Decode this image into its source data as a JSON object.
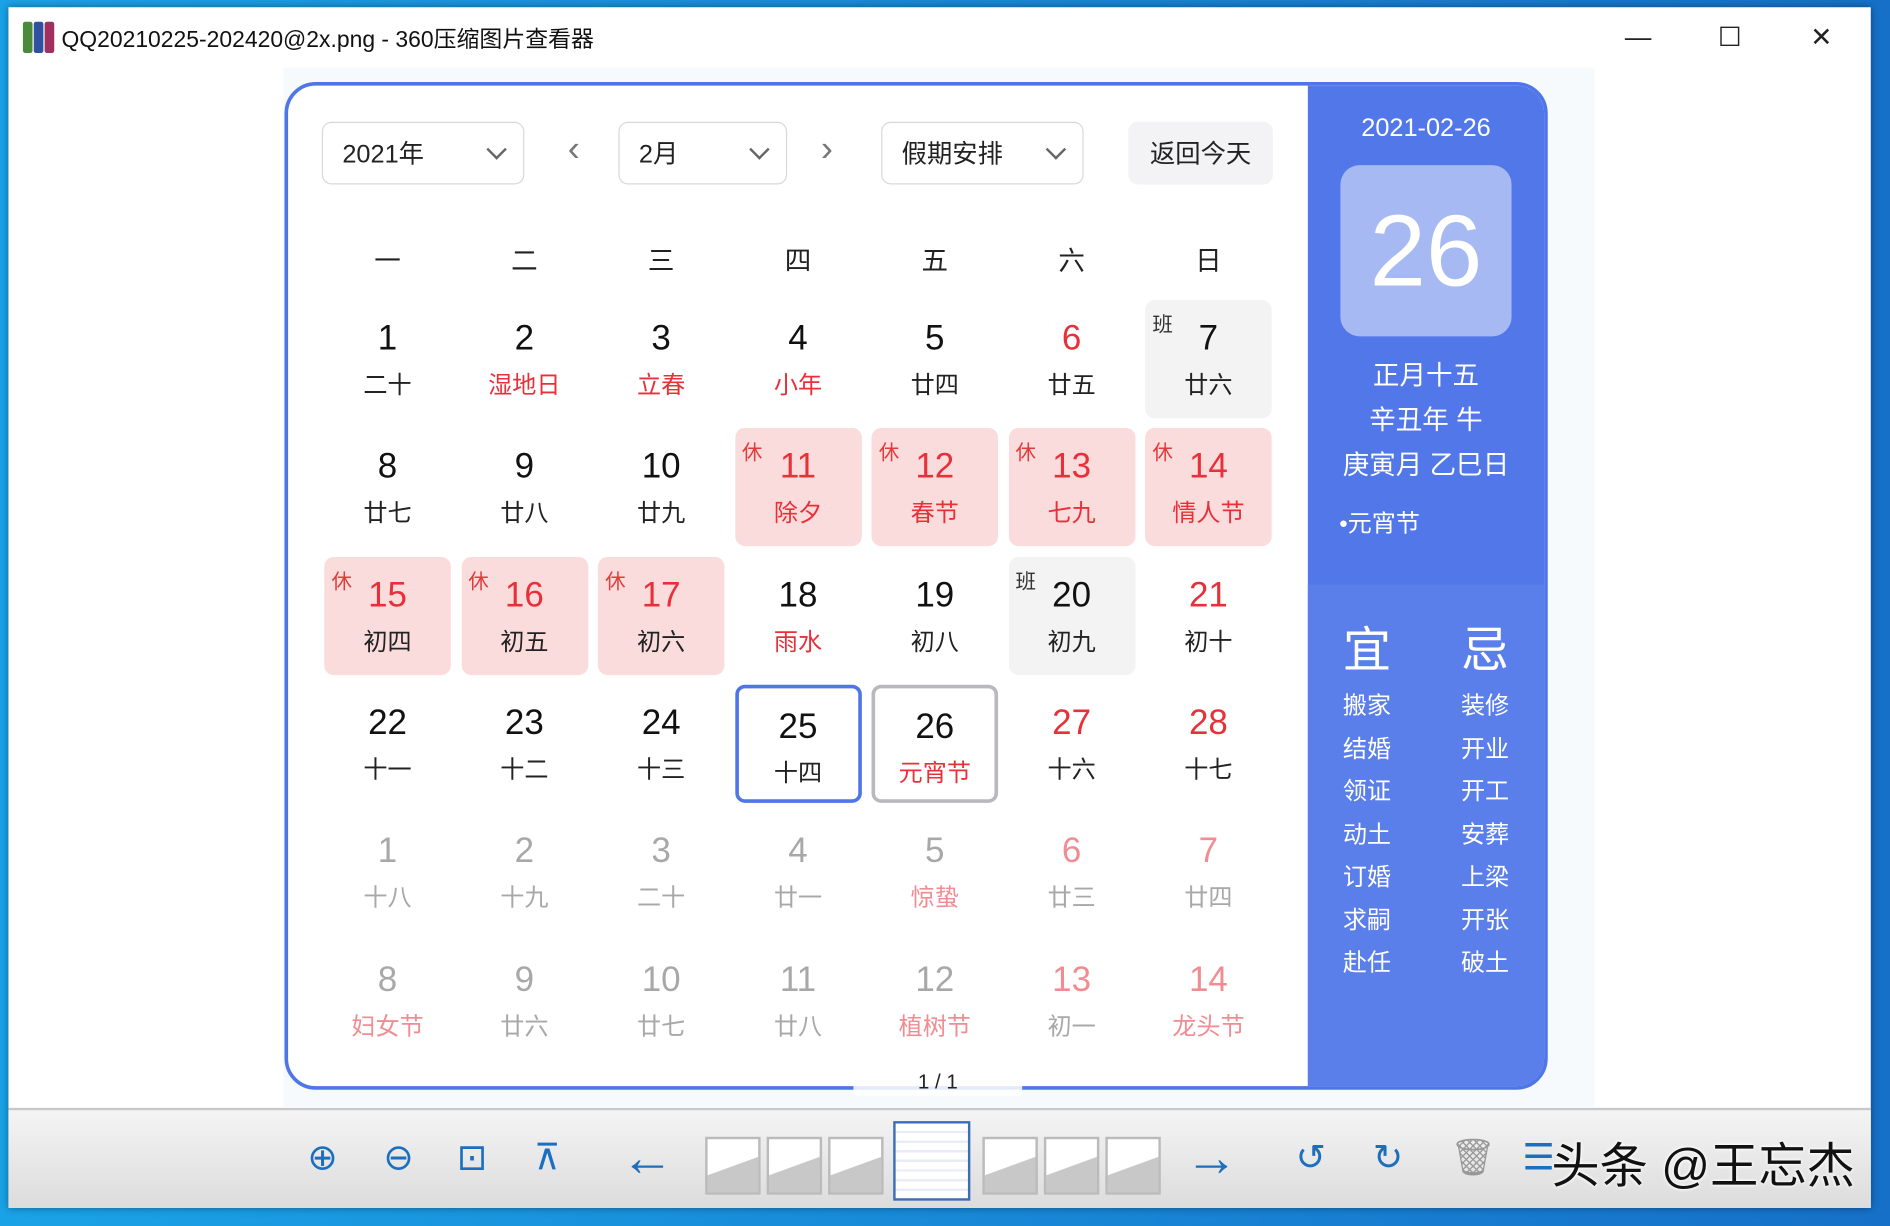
{
  "window": {
    "title": "QQ20210225-202420@2x.png - 360压缩图片查看器",
    "minimize": "—",
    "maximize": "☐",
    "close": "✕"
  },
  "calendar": {
    "year_select": "2021年",
    "month_select": "2月",
    "holiday_select": "假期安排",
    "prev": "‹",
    "next": "›",
    "today_button": "返回今天",
    "weekdays": [
      "一",
      "二",
      "三",
      "四",
      "五",
      "六",
      "日"
    ],
    "rows": [
      [
        {
          "d": "1",
          "l": "二十"
        },
        {
          "d": "2",
          "l": "湿地日",
          "lred": true
        },
        {
          "d": "3",
          "l": "立春",
          "lred": true
        },
        {
          "d": "4",
          "l": "小年",
          "lred": true
        },
        {
          "d": "5",
          "l": "廿四"
        },
        {
          "d": "6",
          "l": "廿五",
          "red": true
        },
        {
          "d": "7",
          "l": "廿六",
          "tag": "班",
          "bg": "work"
        }
      ],
      [
        {
          "d": "8",
          "l": "廿七"
        },
        {
          "d": "9",
          "l": "廿八"
        },
        {
          "d": "10",
          "l": "廿九"
        },
        {
          "d": "11",
          "l": "除夕",
          "tag": "休",
          "bg": "rest",
          "red": true,
          "lred": true
        },
        {
          "d": "12",
          "l": "春节",
          "tag": "休",
          "bg": "rest",
          "red": true,
          "lred": true
        },
        {
          "d": "13",
          "l": "七九",
          "tag": "休",
          "bg": "rest",
          "red": true,
          "lred": true
        },
        {
          "d": "14",
          "l": "情人节",
          "tag": "休",
          "bg": "rest",
          "red": true,
          "lred": true
        }
      ],
      [
        {
          "d": "15",
          "l": "初四",
          "tag": "休",
          "bg": "rest",
          "red": true
        },
        {
          "d": "16",
          "l": "初五",
          "tag": "休",
          "bg": "rest",
          "red": true
        },
        {
          "d": "17",
          "l": "初六",
          "tag": "休",
          "bg": "rest",
          "red": true
        },
        {
          "d": "18",
          "l": "雨水",
          "lred": true
        },
        {
          "d": "19",
          "l": "初八"
        },
        {
          "d": "20",
          "l": "初九",
          "tag": "班",
          "bg": "work"
        },
        {
          "d": "21",
          "l": "初十",
          "red": true
        }
      ],
      [
        {
          "d": "22",
          "l": "十一"
        },
        {
          "d": "23",
          "l": "十二"
        },
        {
          "d": "24",
          "l": "十三"
        },
        {
          "d": "25",
          "l": "十四",
          "state": "today"
        },
        {
          "d": "26",
          "l": "元宵节",
          "lred": true,
          "state": "selected"
        },
        {
          "d": "27",
          "l": "十六",
          "red": true
        },
        {
          "d": "28",
          "l": "十七",
          "red": true
        }
      ],
      [
        {
          "d": "1",
          "l": "十八",
          "faded": true
        },
        {
          "d": "2",
          "l": "十九",
          "faded": true
        },
        {
          "d": "3",
          "l": "二十",
          "faded": true
        },
        {
          "d": "4",
          "l": "廿一",
          "faded": true
        },
        {
          "d": "5",
          "l": "惊蛰",
          "lred": true,
          "faded": true
        },
        {
          "d": "6",
          "l": "廿三",
          "red": true,
          "faded": true
        },
        {
          "d": "7",
          "l": "廿四",
          "red": true,
          "faded": true
        }
      ],
      [
        {
          "d": "8",
          "l": "妇女节",
          "lred": true,
          "faded": true
        },
        {
          "d": "9",
          "l": "廿六",
          "faded": true
        },
        {
          "d": "10",
          "l": "廿七",
          "faded": true
        },
        {
          "d": "11",
          "l": "廿八",
          "faded": true
        },
        {
          "d": "12",
          "l": "植树节",
          "lred": true,
          "faded": true
        },
        {
          "d": "13",
          "l": "初一",
          "red": true,
          "faded": true
        },
        {
          "d": "14",
          "l": "龙头节",
          "red": true,
          "lred": true,
          "faded": true
        }
      ]
    ]
  },
  "detail": {
    "date": "2021-02-26",
    "day": "26",
    "lunar": "正月十五",
    "year_gz": "辛丑年 牛",
    "month_day_gz": "庚寅月 乙巳日",
    "festival": "•元宵节",
    "yi_title": "宜",
    "yi": [
      "搬家",
      "结婚",
      "领证",
      "动土",
      "订婚",
      "求嗣",
      "赴任"
    ],
    "ji_title": "忌",
    "ji": [
      "装修",
      "开业",
      "开工",
      "安葬",
      "上梁",
      "开张",
      "破土"
    ]
  },
  "pager": "1 / 1",
  "toolbar": {
    "zoom_in": "zoom-in-icon",
    "zoom_out": "zoom-out-icon",
    "fit": "fit-icon",
    "slideshow": "slideshow-icon",
    "prev": "←",
    "next": "→",
    "rotate_left": "↺",
    "rotate_right": "↻"
  },
  "watermark": "头条 @王忘杰",
  "colors": {
    "accent": "#4e76e8",
    "red": "#e8303a",
    "rest_bg": "#fbdcdc"
  }
}
